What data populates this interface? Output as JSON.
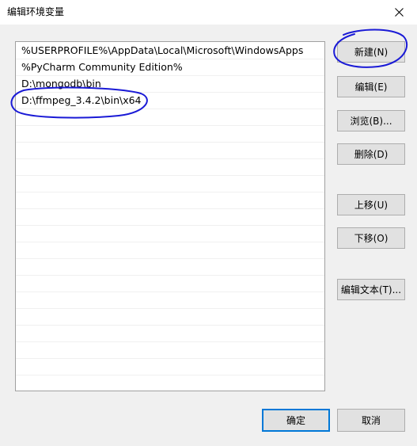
{
  "window": {
    "title": "编辑环境变量"
  },
  "path_list": {
    "items": [
      "%USERPROFILE%\\AppData\\Local\\Microsoft\\WindowsApps",
      "%PyCharm Community Edition%",
      "D:\\mongodb\\bin",
      "D:\\ffmpeg_3.4.2\\bin\\x64"
    ],
    "empty_row_count": 17
  },
  "buttons": {
    "new": "新建(N)",
    "edit": "编辑(E)",
    "browse": "浏览(B)...",
    "delete": "删除(D)",
    "move_up": "上移(U)",
    "move_down": "下移(O)",
    "edit_text": "编辑文本(T)...",
    "ok": "确定",
    "cancel": "取消"
  },
  "icons": {
    "close": "close-icon"
  },
  "colors": {
    "dialog_bg": "#f0f0f0",
    "button_bg": "#e1e1e1",
    "focus_border": "#0078d7",
    "annotation_ink": "#1a1ad6"
  }
}
